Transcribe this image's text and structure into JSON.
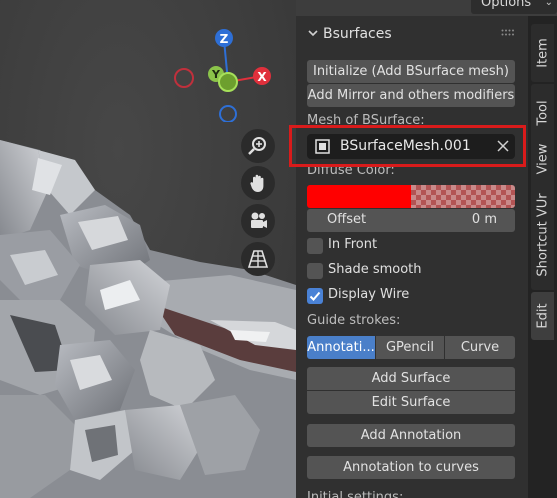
{
  "header": {
    "options_label": "Options"
  },
  "gizmo": {
    "z_label": "Z",
    "y_label": "Y",
    "x_label": "X",
    "colors": {
      "z": "#2e6fd6",
      "y": "#8bc34a",
      "x": "#e0303c"
    }
  },
  "viewport_nav": {
    "icons": [
      "zoom-icon",
      "hand-pan-icon",
      "camera-icon",
      "perspective-grid-icon"
    ]
  },
  "panel": {
    "title": "Bsurfaces",
    "initialize_label": "Initialize (Add BSurface mesh)",
    "add_mirror_label": "Add Mirror and others modifiers",
    "mesh_label": "Mesh of BSurface:",
    "mesh_value": "BSurfaceMesh.001",
    "diffuse_label": "Diffuse Color:",
    "diffuse_color": "#ff0000",
    "offset_label": "Offset",
    "offset_value": "0 m",
    "in_front_label": "In Front",
    "in_front_checked": false,
    "shade_smooth_label": "Shade smooth",
    "shade_smooth_checked": false,
    "display_wire_label": "Display Wire",
    "display_wire_checked": true,
    "guide_label": "Guide strokes:",
    "guide_options": [
      "Annotati...",
      "GPencil",
      "Curve"
    ],
    "guide_selected": "Annotati...",
    "add_surface_label": "Add Surface",
    "edit_surface_label": "Edit Surface",
    "add_annotation_label": "Add Annotation",
    "annotation_to_curves_label": "Annotation to curves",
    "initial_settings_label": "Initial settings:"
  },
  "tabs": [
    "Item",
    "Tool",
    "View",
    "Shortcut VUr",
    "Edit"
  ],
  "active_tab": "Edit",
  "accent_color": "#4a7fc9"
}
